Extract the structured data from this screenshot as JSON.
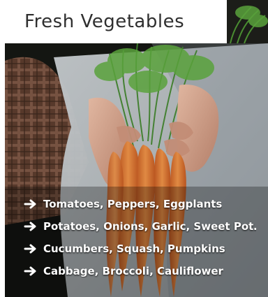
{
  "header": {
    "title": "Fresh Vegetables"
  },
  "list": {
    "items": [
      {
        "label": "Tomatoes, Peppers, Eggplants",
        "icon": "arrow-right-icon"
      },
      {
        "label": "Potatoes, Onions, Garlic, Sweet Pot…",
        "icon": "arrow-right-icon"
      },
      {
        "label": "Cucumbers, Squash, Pumpkins",
        "icon": "arrow-right-icon"
      },
      {
        "label": "Cabbage, Broccoli, Cauliflower",
        "icon": "arrow-right-icon"
      }
    ]
  },
  "colors": {
    "title_text": "#2f2f2f",
    "list_text": "#ffffff",
    "carrot": "#d7772f",
    "leaf": "#3f7f2c"
  }
}
